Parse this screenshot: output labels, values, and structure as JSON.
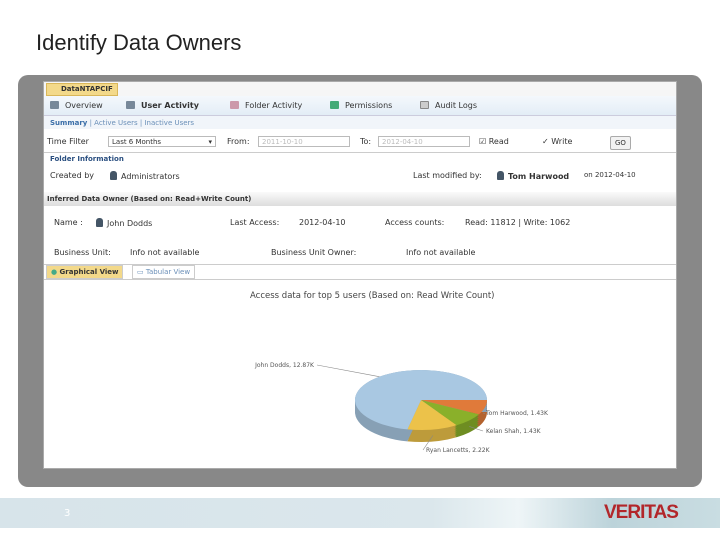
{
  "slide": {
    "title": "Identify Data Owners",
    "page_number": "3",
    "logo": "VERITAS"
  },
  "app": {
    "doc_tab": "DataNTAPCIF",
    "nav": [
      "Overview",
      "User Activity",
      "Folder Activity",
      "Permissions",
      "Audit Logs"
    ],
    "subtabs": [
      "Summary",
      "Active Users",
      "Inactive Users"
    ],
    "filter": {
      "label": "Time Filter",
      "value": "Last 6 Months",
      "from_label": "From:",
      "from": "2011-10-10",
      "to_label": "To:",
      "to": "2012-04-10",
      "read": "Read",
      "write": "Write",
      "go": "GO"
    },
    "folder_info": {
      "legend": "Folder Information",
      "created_label": "Created by",
      "created_by": "Administrators",
      "modified_label": "Last modified by:",
      "modified_by": "Tom Harwood",
      "modified_on": "on 2012-04-10"
    },
    "owner": {
      "heading": "Inferred Data Owner (Based on: Read+Write Count)",
      "name_label": "Name :",
      "name": "John Dodds",
      "last_access_label": "Last Access:",
      "last_access": "2012-04-10",
      "counts_label": "Access counts:",
      "counts": "Read: 11812 | Write: 1062",
      "bu_label": "Business Unit:",
      "bu": "Info not available",
      "bu_owner_label": "Business Unit Owner:",
      "bu_owner": "Info not available"
    },
    "view_tabs": [
      "Graphical View",
      "Tabular View"
    ]
  },
  "chart_data": {
    "type": "pie",
    "title": "Access data for top 5 users  (Based on: Read Write Count)",
    "slices": [
      {
        "name": "Tom Harwood",
        "value": 1.43,
        "label": "Tom Harwood, 1.43K",
        "color": "#e07a3a"
      },
      {
        "name": "Kelan Shah",
        "value": 1.43,
        "label": "Kelan Shah, 1.43K",
        "color": "#8ab02a"
      },
      {
        "name": "Ryan Lancetts",
        "value": 2.22,
        "label": "Ryan Lancetts, 2.22K",
        "color": "#ecc24a"
      },
      {
        "name": "John Dodds",
        "value": 12.87,
        "label": "John Dodds, 12.87K",
        "color": "#a9c8e2"
      }
    ]
  }
}
